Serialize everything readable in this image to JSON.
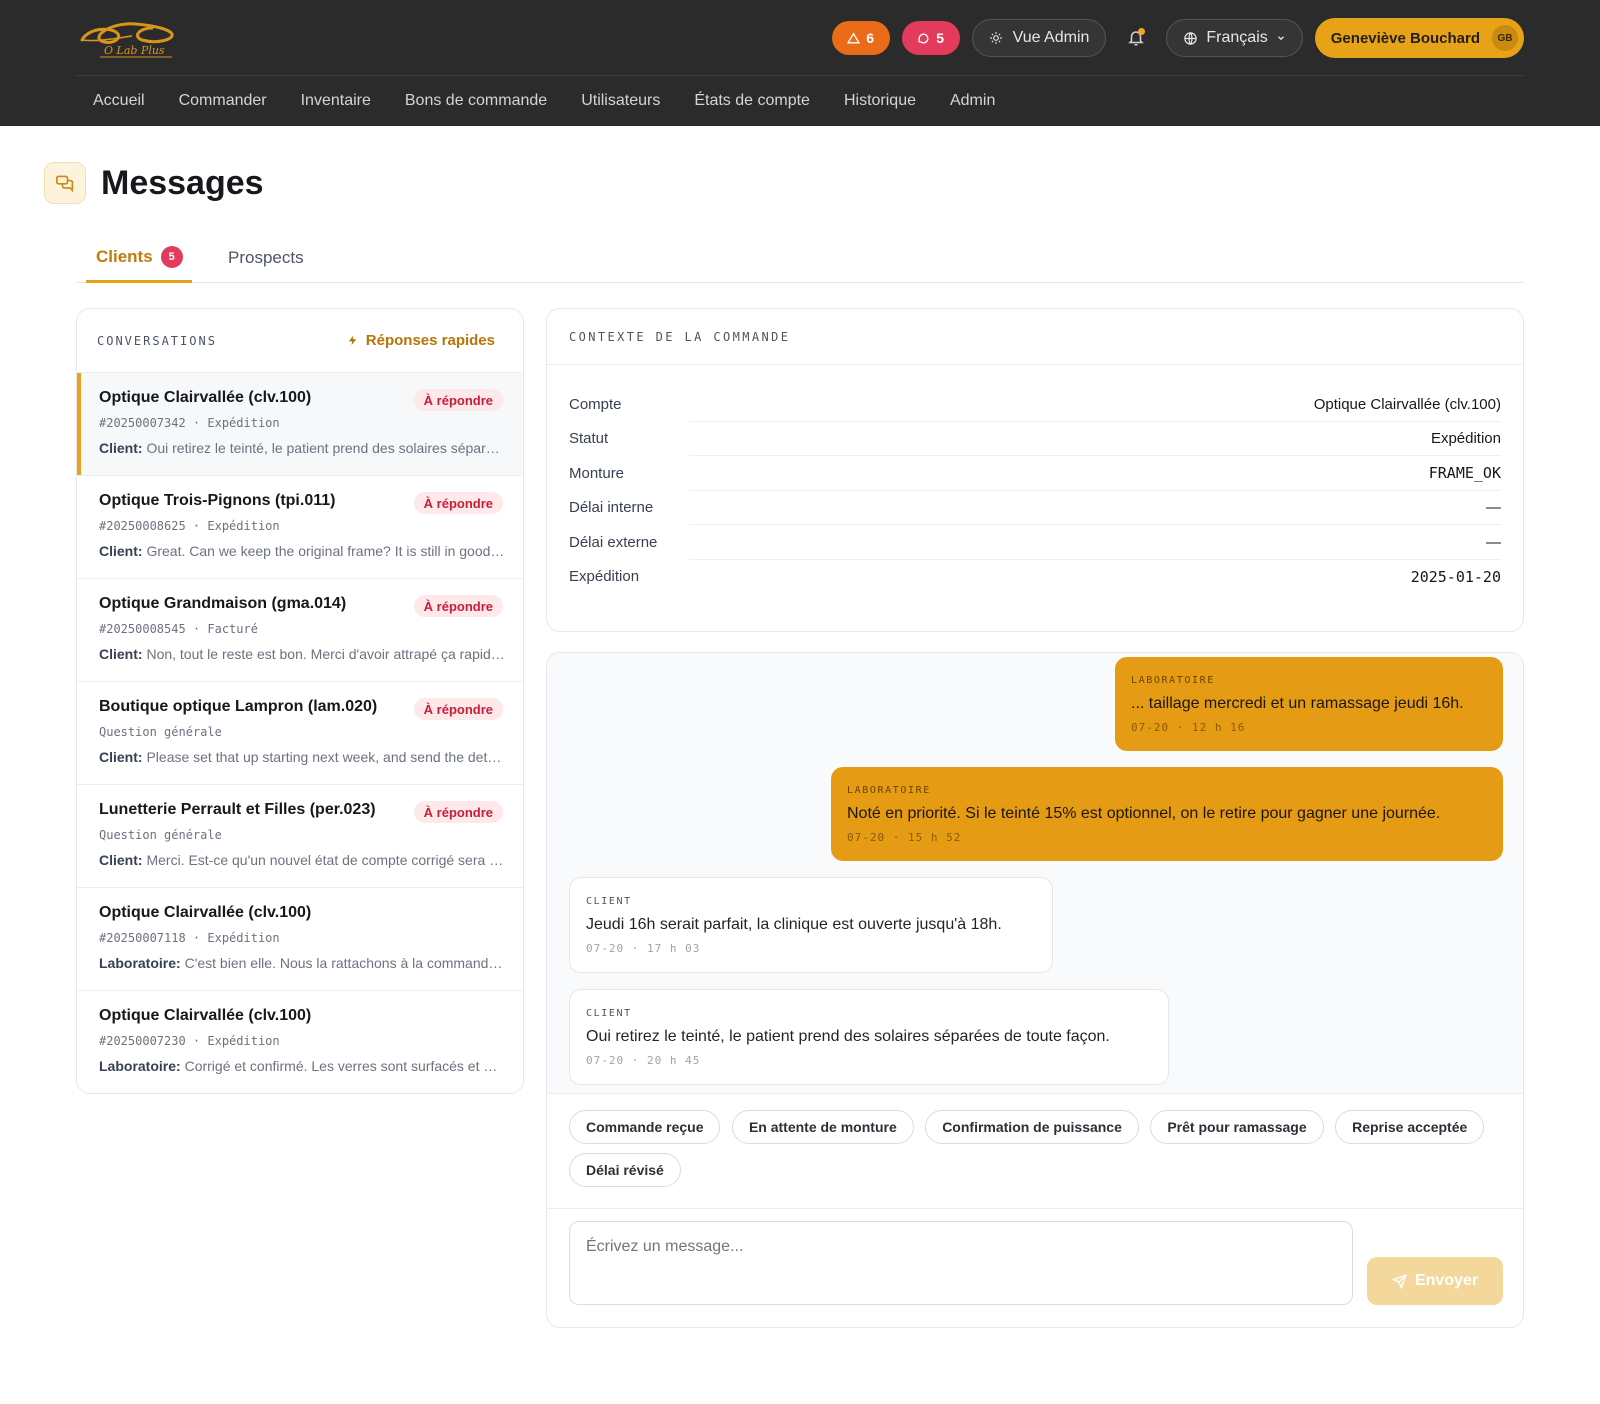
{
  "header": {
    "logo_text": "O Lab Plus",
    "alerts_count": "6",
    "messages_count": "5",
    "admin_view_label": "Vue Admin",
    "language_label": "Français",
    "user_name": "Geneviève Bouchard",
    "user_initials": "GB"
  },
  "nav": {
    "items": [
      "Accueil",
      "Commander",
      "Inventaire",
      "Bons de commande",
      "Utilisateurs",
      "États de compte",
      "Historique",
      "Admin"
    ]
  },
  "page": {
    "title": "Messages"
  },
  "tabs": {
    "clients_label": "Clients",
    "clients_count": "5",
    "prospects_label": "Prospects"
  },
  "conversations": {
    "title": "CONVERSATIONS",
    "quick_replies_label": "Réponses rapides",
    "items": [
      {
        "name": "Optique Clairvallée (clv.100)",
        "status": "À répondre",
        "meta": "#20250007342 · Expédition",
        "author": "Client:",
        "preview": "Oui retirez le teinté, le patient prend des solaires séparées de toute façon."
      },
      {
        "name": "Optique Trois-Pignons (tpi.011)",
        "status": "À répondre",
        "meta": "#20250008625 · Expédition",
        "author": "Client:",
        "preview": "Great. Can we keep the original frame? It is still in good shape."
      },
      {
        "name": "Optique Grandmaison (gma.014)",
        "status": "À répondre",
        "meta": "#20250008545 · Facturé",
        "author": "Client:",
        "preview": "Non, tout le reste est bon. Merci d'avoir attrapé ça rapidement."
      },
      {
        "name": "Boutique optique Lampron (lam.020)",
        "status": "À répondre",
        "meta": "Question générale",
        "author": "Client:",
        "preview": "Please set that up starting next week, and send the details by email."
      },
      {
        "name": "Lunetterie Perrault et Filles (per.023)",
        "status": "À répondre",
        "meta": "Question générale",
        "author": "Client:",
        "preview": "Merci. Est-ce qu'un nouvel état de compte corrigé sera envoyé?"
      },
      {
        "name": "Optique Clairvallée (clv.100)",
        "status": "",
        "meta": "#20250007118 · Expédition",
        "author": "Laboratoire:",
        "preview": "C'est bien elle. Nous la rattachons à la commande maintenant."
      },
      {
        "name": "Optique Clairvallée (clv.100)",
        "status": "",
        "meta": "#20250007230 · Expédition",
        "author": "Laboratoire:",
        "preview": "Corrigé et confirmé. Les verres sont surfacés et prêts demain."
      }
    ]
  },
  "context": {
    "title": "CONTEXTE DE LA COMMANDE",
    "rows": [
      {
        "label": "Compte",
        "value": "Optique Clairvallée (clv.100)"
      },
      {
        "label": "Statut",
        "value": "Expédition"
      },
      {
        "label": "Monture",
        "value": "FRAME_OK"
      },
      {
        "label": "Délai interne",
        "value": "—"
      },
      {
        "label": "Délai externe",
        "value": "—"
      },
      {
        "label": "Expédition",
        "value": "2025-01-20"
      }
    ]
  },
  "chat": {
    "messages": [
      {
        "who": "LABORATOIRE",
        "text": "... taillage mercredi et un ramassage jeudi 16h.",
        "time": "07-20 · 12 h 16"
      },
      {
        "who": "LABORATOIRE",
        "text": "Noté en priorité. Si le teinté 15% est optionnel, on le retire pour gagner une journée.",
        "time": "07-20 · 15 h 52"
      },
      {
        "who": "CLIENT",
        "text": "Jeudi 16h serait parfait, la clinique est ouverte jusqu'à 18h.",
        "time": "07-20 · 17 h 03"
      },
      {
        "who": "CLIENT",
        "text": "Oui retirez le teinté, le patient prend des solaires séparées de toute façon.",
        "time": "07-20 · 20 h 45"
      }
    ],
    "quick_replies": [
      "Commande reçue",
      "En attente de monture",
      "Confirmation de puissance",
      "Prêt pour ramassage",
      "Reprise acceptée",
      "Délai révisé"
    ],
    "compose_placeholder": "Écrivez un message...",
    "send_label": "Envoyer"
  },
  "colors": {
    "accent": "#e8a218",
    "topbar": "#2b2b2b",
    "alert": "#ea6b18",
    "danger": "#e23b5b"
  }
}
